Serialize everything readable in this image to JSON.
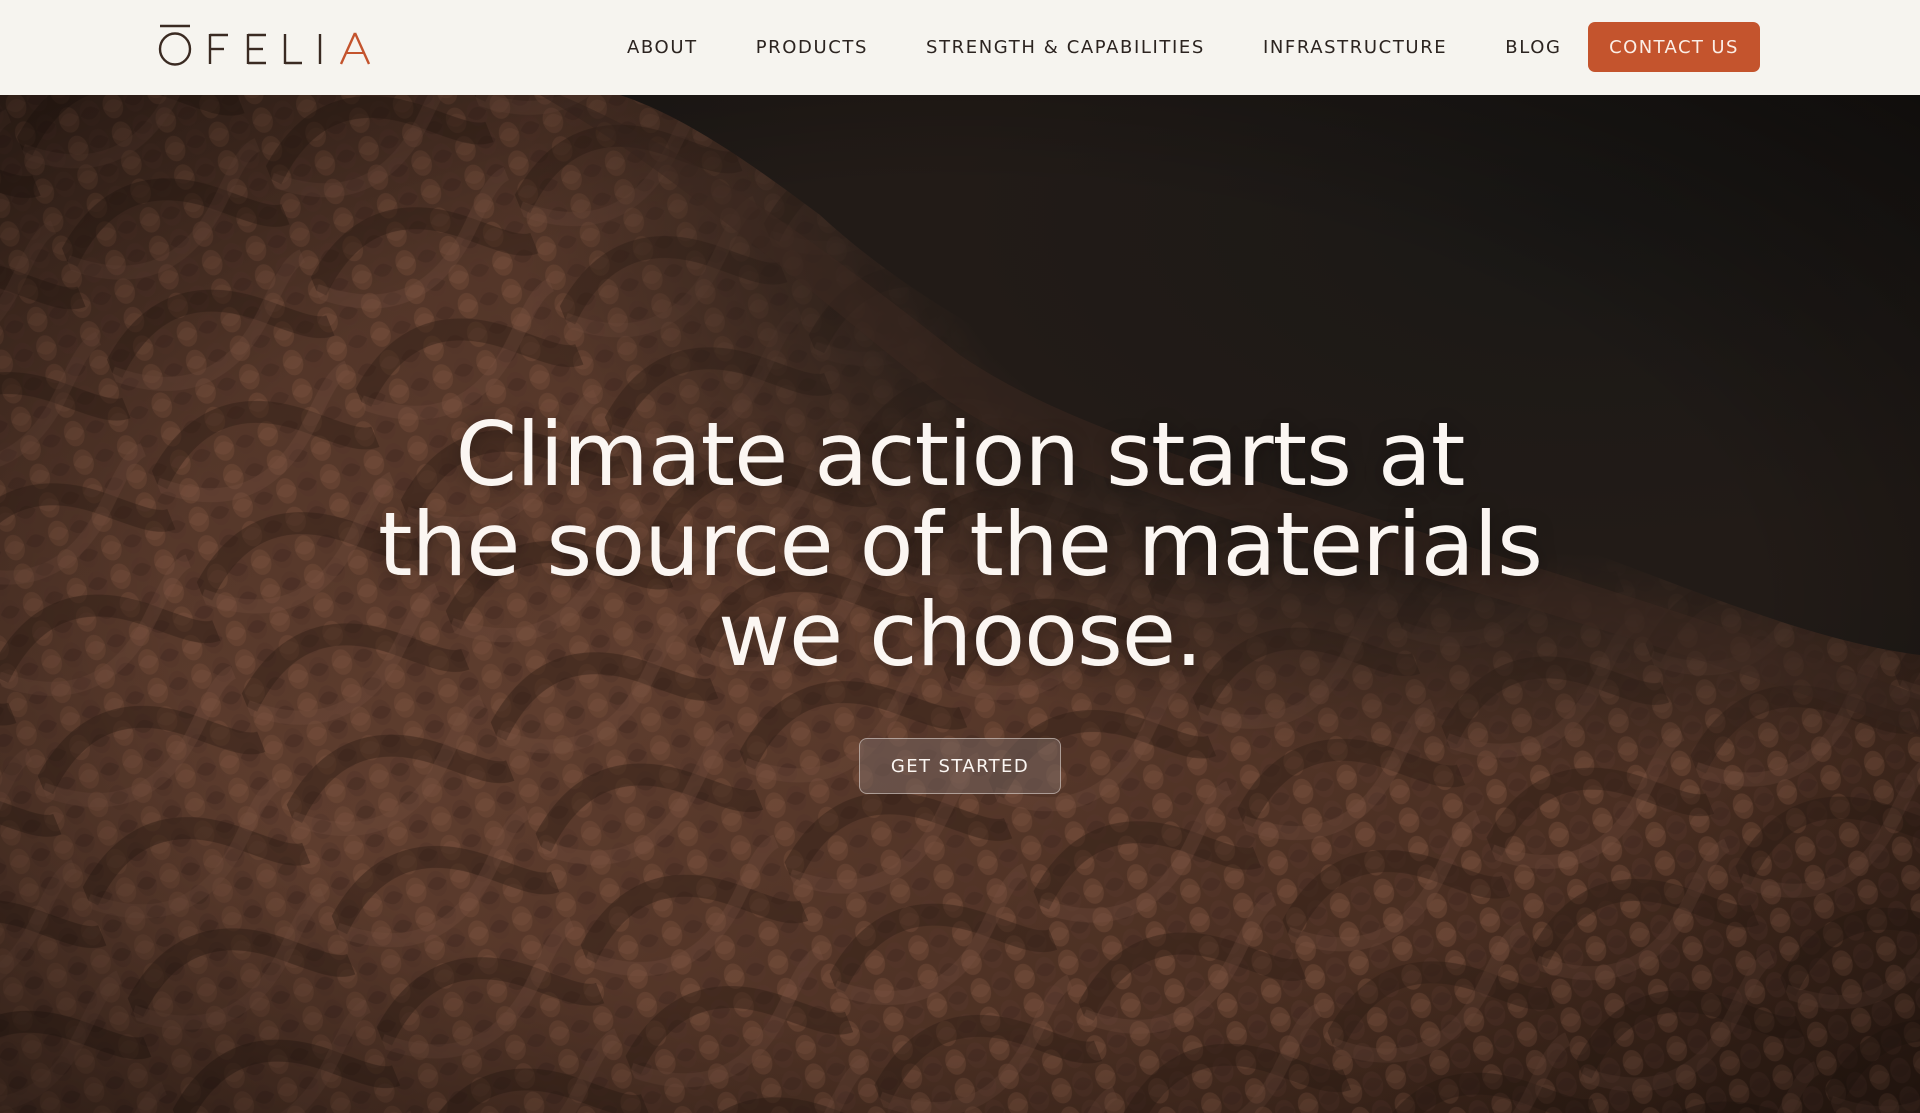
{
  "brand": {
    "logo_text": "OFELIA",
    "accent_color": "#c4542d"
  },
  "nav": {
    "items": [
      {
        "label": "ABOUT"
      },
      {
        "label": "PRODUCTS"
      },
      {
        "label": "STRENGTH & CAPABILITIES"
      },
      {
        "label": "INFRASTRUCTURE"
      },
      {
        "label": "BLOG"
      }
    ],
    "contact_label": "CONTACT US"
  },
  "hero": {
    "title_lines": [
      "Climate action starts at",
      "the source of the materials",
      "we choose."
    ],
    "cta_label": "GET STARTED",
    "background": "knitted-wool-photo"
  }
}
